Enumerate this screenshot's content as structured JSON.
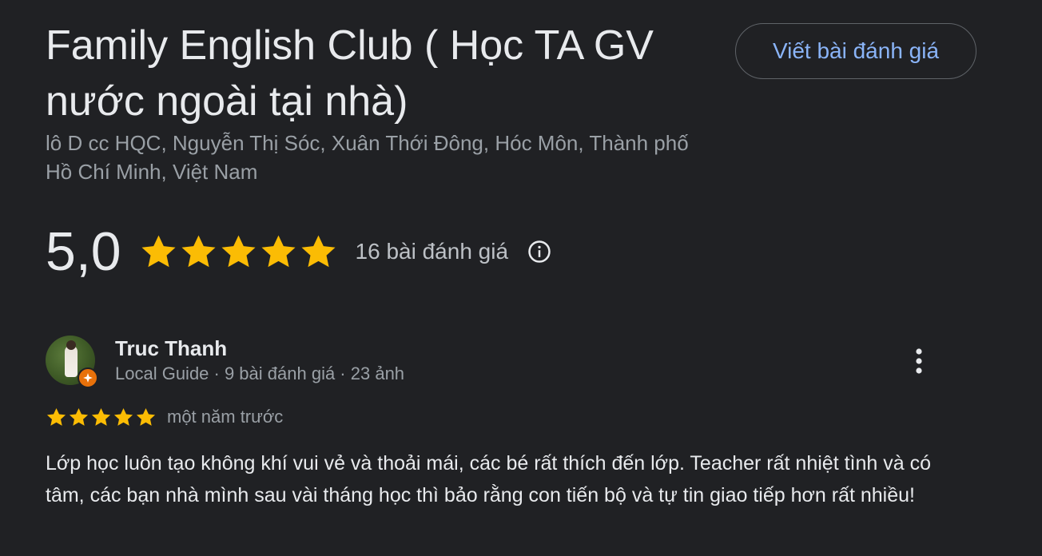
{
  "place": {
    "title": "Family English Club ( Học TA GV nước ngoài tại nhà)",
    "address": "lô D cc HQC, Nguyễn Thị Sóc, Xuân Thới Đông, Hóc Môn, Thành phố Hồ Chí Minh, Việt Nam",
    "write_review_label": "Viết bài đánh giá"
  },
  "rating": {
    "value": "5,0",
    "stars": 5,
    "review_count": "16 bài đánh giá",
    "info_icon": "info-icon"
  },
  "review": {
    "reviewer_name": "Truc Thanh",
    "reviewer_meta": "Local Guide · 9 bài đánh giá · 23 ảnh",
    "stars": 5,
    "time": "một năm trước",
    "text": "Lớp học luôn tạo không khí vui vẻ và thoải mái, các bé rất thích đến lớp. Teacher rất nhiệt tình và có tâm, các bạn nhà mình sau vài tháng học thì bảo rằng con tiến bộ và tự tin giao tiếp hơn rất nhiều!",
    "more_icon": "more-vert-icon",
    "badge_icon": "local-guide-badge-icon"
  },
  "colors": {
    "background": "#202124",
    "star": "#fbbc04",
    "link": "#8ab4f8",
    "badge": "#e8710a",
    "primary_text": "#e8eaed",
    "secondary_text": "#9aa0a6"
  }
}
